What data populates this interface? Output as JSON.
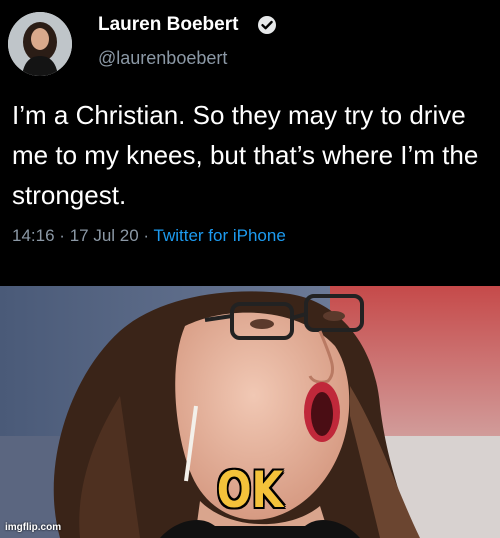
{
  "tweet": {
    "display_name": "Lauren Boebert",
    "handle": "@laurenboebert",
    "verified_icon": "verified-badge-icon",
    "text": "I’m a Christian. So they may try to drive me to my knees, but that’s where I’m the strongest.",
    "time": "14:16",
    "separator": "·",
    "date": "17 Jul 20",
    "source": "Twitter for iPhone"
  },
  "meme": {
    "caption": "OK",
    "watermark": "imgflip.com"
  },
  "colors": {
    "tweet_background": "#000000",
    "muted_text": "#8b98a5",
    "link_blue": "#1d9bf0",
    "caption_yellow": "#f4c23a"
  }
}
